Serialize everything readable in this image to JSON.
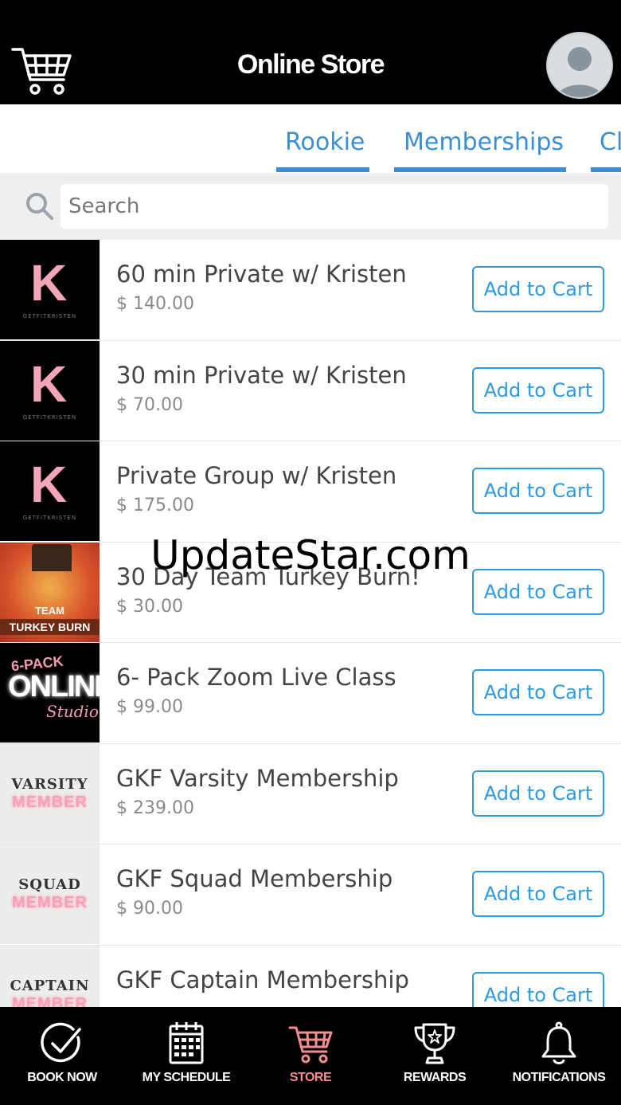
{
  "header": {
    "title": "Online Store",
    "cart_icon": "shopping-cart-icon",
    "avatar_icon": "user-avatar-icon"
  },
  "tabs": [
    {
      "label": "Rookie"
    },
    {
      "label": "Memberships"
    },
    {
      "label": "Cl"
    }
  ],
  "search": {
    "placeholder": "Search",
    "value": ""
  },
  "products": [
    {
      "name": "60 min Private w/ Kristen",
      "price": "$ 140.00",
      "button": "Add to Cart"
    },
    {
      "name": "30 min Private w/ Kristen",
      "price": "$ 70.00",
      "button": "Add to Cart"
    },
    {
      "name": "Private Group w/ Kristen",
      "price": "$ 175.00",
      "button": "Add to Cart"
    },
    {
      "name": "30 Day Team Turkey Burn!",
      "price": "$ 30.00",
      "button": "Add to Cart",
      "thumb_text": [
        "TEAM",
        "TURKEY BURN"
      ]
    },
    {
      "name": "6- Pack Zoom Live Class",
      "price": "$ 99.00",
      "button": "Add to Cart",
      "thumb_text": [
        "6-PACK",
        "ONLINE",
        "Studio"
      ]
    },
    {
      "name": "GKF Varsity Membership",
      "price": "$ 239.00",
      "button": "Add to Cart",
      "thumb_text": [
        "VARSITY",
        "MEMBER"
      ]
    },
    {
      "name": "GKF Squad Membership",
      "price": "$ 90.00",
      "button": "Add to Cart",
      "thumb_text": [
        "SQUAD",
        "MEMBER"
      ]
    },
    {
      "name": "GKF Captain Membership",
      "price": "",
      "button": "Add to Cart",
      "thumb_text": [
        "CAPTAIN",
        "MEMBER"
      ]
    }
  ],
  "kristen_logo": {
    "letter": "K",
    "sub": "GETFITKRISTEN"
  },
  "watermark": "UpdateStar.com",
  "bottom_nav": [
    {
      "label": "BOOK NOW",
      "icon": "check-circle-icon"
    },
    {
      "label": "MY SCHEDULE",
      "icon": "calendar-icon"
    },
    {
      "label": "STORE",
      "icon": "shopping-cart-icon",
      "active": true
    },
    {
      "label": "REWARDS",
      "icon": "trophy-icon"
    },
    {
      "label": "NOTIFICATIONS",
      "icon": "bell-icon"
    }
  ],
  "colors": {
    "accent": "#3a8ed8",
    "button_border": "#2f9ae0",
    "active_nav": "#ef8f8f",
    "header_bg": "#000000"
  }
}
